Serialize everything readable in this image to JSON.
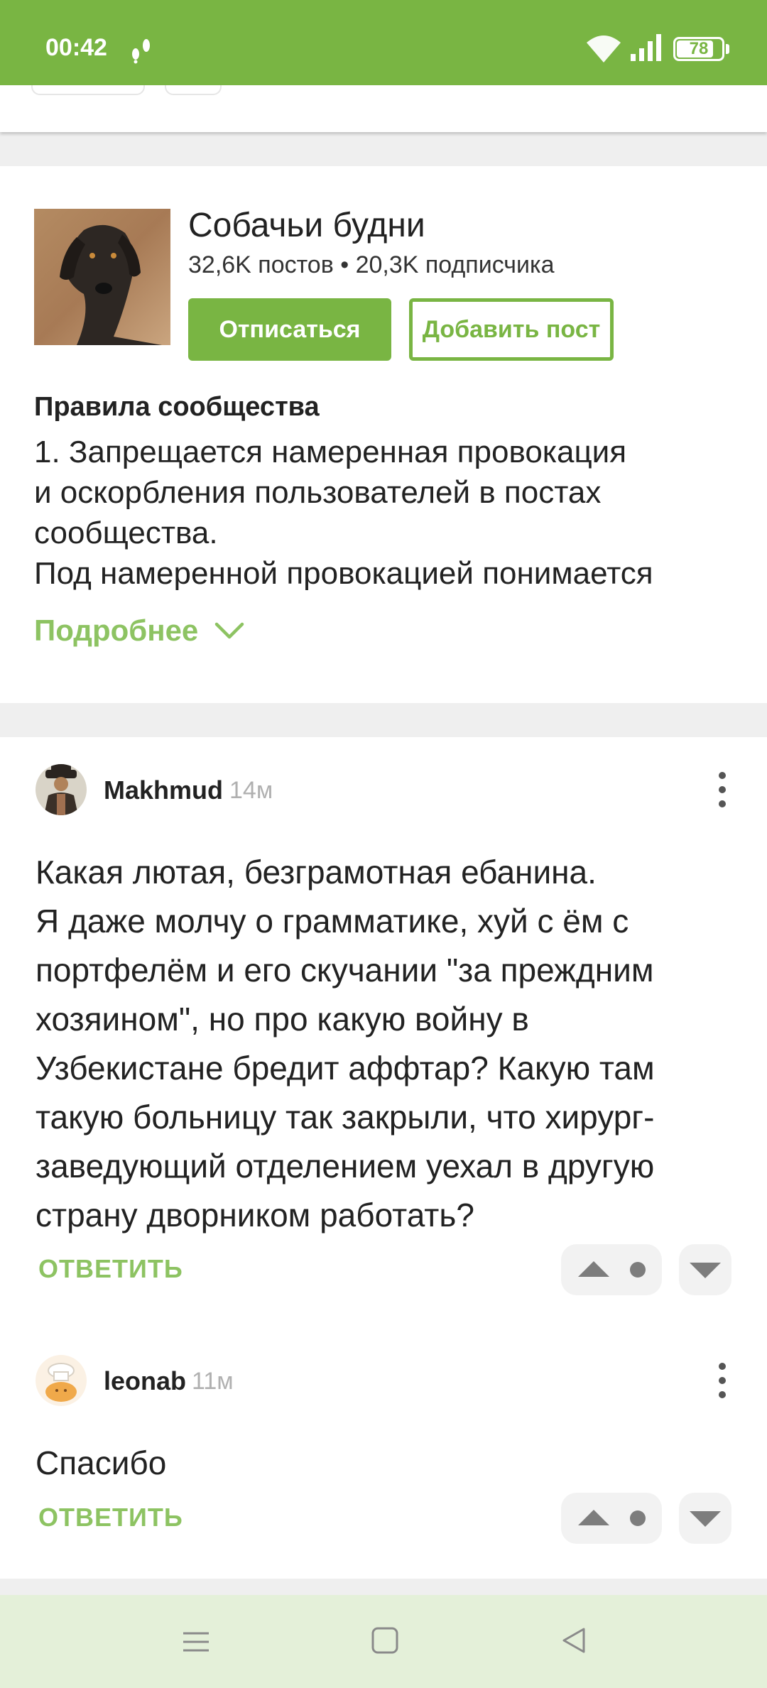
{
  "status_bar": {
    "time": "00:42",
    "battery_level": "78",
    "icons": [
      "notification-icon",
      "wifi-icon",
      "signal-icon",
      "battery-icon"
    ]
  },
  "community": {
    "name": "Собачьи будни",
    "stats": "32,6K постов • 20,3K подписчика",
    "unsubscribe_label": "Отписаться",
    "add_post_label": "Добавить пост",
    "rules_title": "Правила сообщества",
    "rules_lines": [
      "1. Запрещается намеренная провокация",
      "и оскорбления пользователей в постах",
      "сообщества.",
      "Под намеренной провокацией понимается"
    ],
    "more_label": "Подробнее"
  },
  "comments": [
    {
      "user": "Makhmud",
      "time": "14м",
      "lines": [
        "Какая лютая, безграмотная ебанина.",
        "Я даже молчу о грамматике, хуй с ём с",
        "портфелём и его скучании \"за преждним",
        "хозяином\", но про какую войну в",
        "Узбекистане бредит аффтар? Какую там",
        "такую больницу так закрыли, что хирург-",
        "заведующий отделением уехал в другую",
        "страну дворником работать?"
      ],
      "reply_label": "ОТВЕТИТЬ"
    },
    {
      "user": "leonab",
      "time": "11м",
      "lines": [
        "Спасибо"
      ],
      "reply_label": "ОТВЕТИТЬ"
    }
  ],
  "colors": {
    "accent": "#79b543",
    "accent_light": "#8dc362",
    "navbar": "#e4f0d9",
    "background": "#efefef"
  },
  "nav_icons": [
    "menu-icon",
    "home-icon",
    "back-icon"
  ]
}
